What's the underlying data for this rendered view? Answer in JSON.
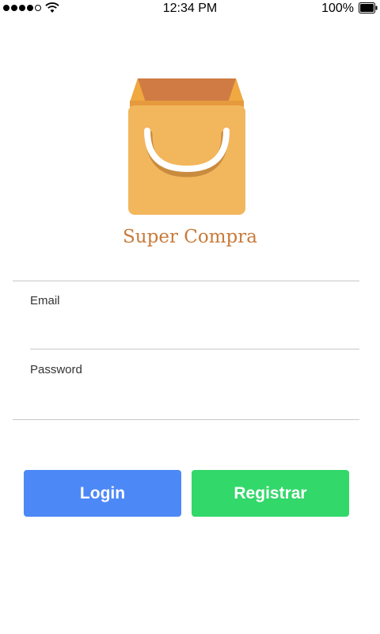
{
  "status_bar": {
    "time": "12:34 PM",
    "battery": "100%",
    "icons": [
      "signal-dots",
      "wifi-icon",
      "battery-icon"
    ]
  },
  "app": {
    "name": "Super Compra",
    "logo": "shopping-bag-icon"
  },
  "form": {
    "email": {
      "label": "Email",
      "value": ""
    },
    "password": {
      "label": "Password",
      "value": ""
    }
  },
  "buttons": {
    "login": "Login",
    "register": "Registrar"
  },
  "colors": {
    "login_button": "#4d88f7",
    "register_button": "#33d86a",
    "brand_text": "#c97a3a",
    "bag_body": "#f2b65c",
    "bag_top": "#d07b44"
  }
}
